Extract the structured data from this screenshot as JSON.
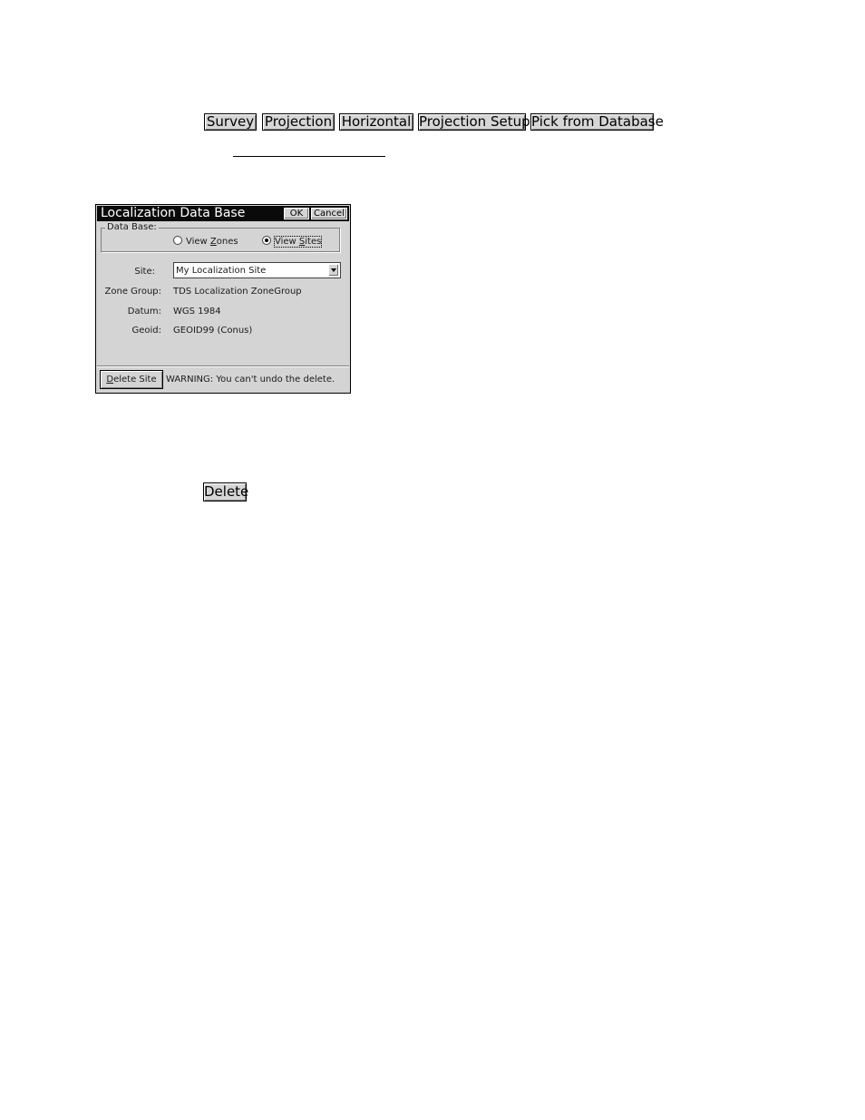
{
  "keycaps": {
    "survey": "Survey",
    "projection": "Projection",
    "horizontal": "Horizontal",
    "projection_setup": "Projection Setup",
    "pick_from_database": "Pick from Database",
    "delete": "Delete"
  },
  "dialog": {
    "title": "Localization Data Base",
    "ok_label": "OK",
    "cancel_label": "Cancel",
    "group_label": "Data Base:",
    "radios": [
      {
        "prefix": "View ",
        "hotkey": "Z",
        "suffix": "ones",
        "selected": false
      },
      {
        "prefix": "View ",
        "hotkey": "S",
        "suffix": "ites",
        "selected": true
      }
    ],
    "site_label": "Site:",
    "site_value": "My Localization Site",
    "zone_group_label": "Zone Group:",
    "zone_group_value": "TDS Localization ZoneGroup",
    "datum_label": "Datum:",
    "datum_value": "WGS 1984",
    "geoid_label": "Geoid:",
    "geoid_value": "GEOID99 (Conus)",
    "delete_site_hotkey": "D",
    "delete_site_rest": "elete Site",
    "warning": "WARNING: You can't undo the delete."
  }
}
